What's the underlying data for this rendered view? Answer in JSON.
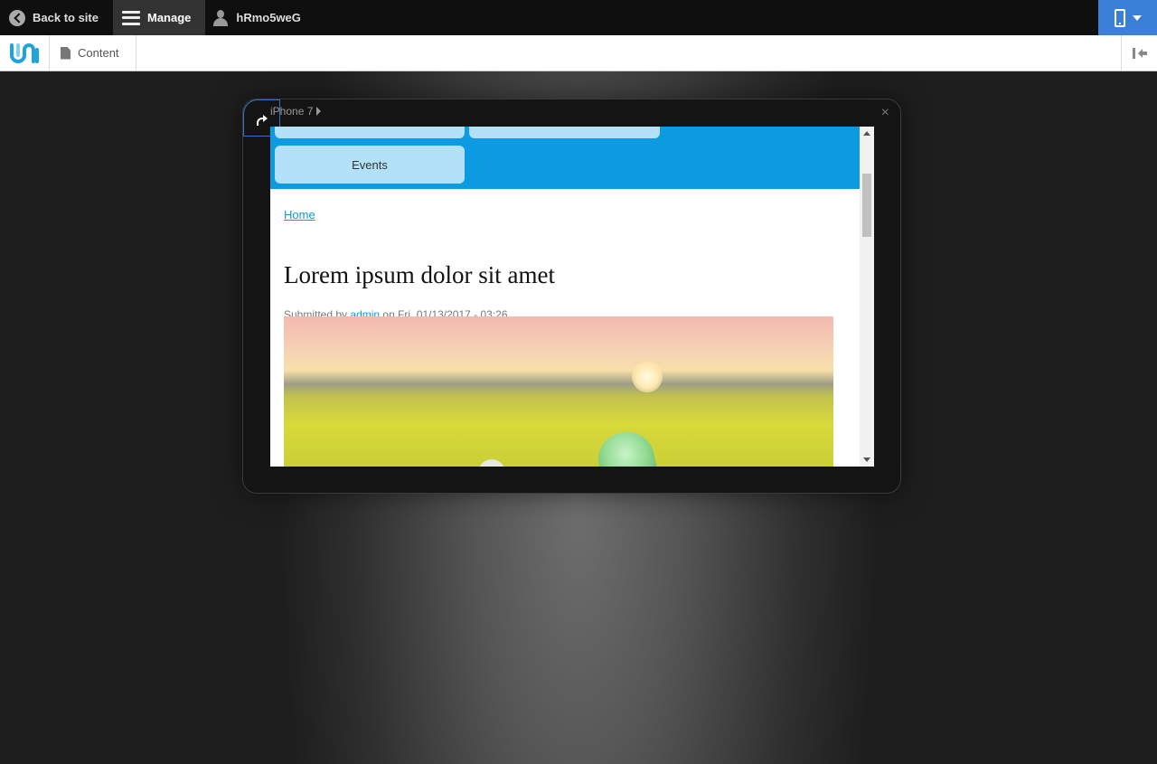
{
  "toolbar": {
    "back_label": "Back to site",
    "manage_label": "Manage",
    "user_label": "hRmo5weG"
  },
  "tray": {
    "content_label": "Content"
  },
  "device": {
    "label": "iPhone 7",
    "close": "×"
  },
  "site": {
    "nav_items": [
      "",
      "",
      "Events"
    ],
    "breadcrumb": "Home",
    "title": "Lorem ipsum dolor sit amet",
    "submitted_prefix": "Submitted by",
    "author": "admin",
    "submitted_suffix": "on Fri, 01/13/2017 - 03:26"
  },
  "colors": {
    "toolbar_bg": "#0f0f0f",
    "device_button": "#3a7fd8",
    "site_nav": "#0c9be0",
    "nav_pill": "#b3e1f7",
    "link": "#0c9be0"
  },
  "icons": {
    "back": "chevron-left-circle-icon",
    "manage": "menu-icon",
    "user": "user-icon",
    "device": "phone-icon",
    "content": "document-icon",
    "tray_toggle": "collapse-left-icon",
    "rotate": "rotate-icon"
  }
}
